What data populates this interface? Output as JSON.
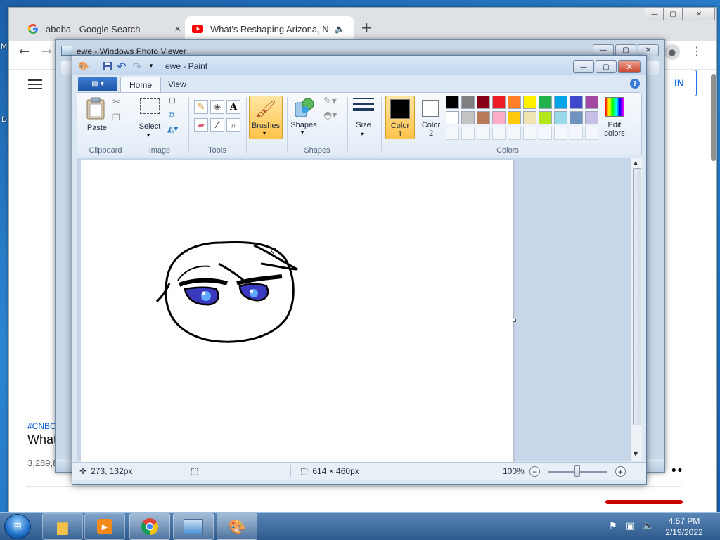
{
  "desktop": {
    "edge_left_top": "M",
    "edge_left_bottom": "D"
  },
  "browser": {
    "tabs": [
      {
        "label": "aboba - Google Search",
        "close": "×"
      },
      {
        "label": "What's Reshaping Arizona, N",
        "close": "×"
      }
    ],
    "new_tab": "+",
    "controls": {
      "minimize": "—",
      "maximize": "▢",
      "close": "✕"
    },
    "nav": {
      "back": "←",
      "forward": "→"
    },
    "page": {
      "sign_in": "IN",
      "hashtag": "#CNBC",
      "video_title": "What",
      "views": "3,289,8",
      "more": "••"
    }
  },
  "photo_viewer": {
    "title": "ewe - Windows Photo Viewer",
    "controls": {
      "minimize": "—",
      "maximize": "▢",
      "close": "✕"
    }
  },
  "paint": {
    "title": "ewe - Paint",
    "file_tab": "▤ ▾",
    "tabs": {
      "home": "Home",
      "view": "View"
    },
    "help": "?",
    "controls": {
      "minimize": "—",
      "maximize": "▢",
      "close": "✕"
    },
    "ribbon": {
      "clipboard": {
        "paste": "Paste",
        "group": "Clipboard"
      },
      "image": {
        "select": "Select",
        "group": "Image"
      },
      "tools": {
        "group": "Tools"
      },
      "brushes": {
        "label": "Brushes"
      },
      "shapes": {
        "label": "Shapes",
        "group": "Shapes"
      },
      "size": {
        "label": "Size"
      },
      "colors": {
        "color1": "Color\n1",
        "color1_line1": "Color",
        "color1_line2": "1",
        "color2_line1": "Color",
        "color2_line2": "2",
        "edit_line1": "Edit",
        "edit_line2": "colors",
        "group": "Colors",
        "color1_value": "#000000",
        "color2_value": "#ffffff",
        "palette_row1": [
          "#000000",
          "#7f7f7f",
          "#880015",
          "#ed1c24",
          "#ff7f27",
          "#fff200",
          "#22b14c",
          "#00a2e8",
          "#3f48cc",
          "#a349a4"
        ],
        "palette_row2": [
          "#ffffff",
          "#c3c3c3",
          "#b97a57",
          "#ffaec9",
          "#ffc90e",
          "#efe4b0",
          "#b5e61d",
          "#99d9ea",
          "#7092be",
          "#c8bfe7"
        ]
      }
    },
    "status": {
      "cursor_pos": "273, 132px",
      "image_size": "614 × 460px",
      "zoom": "100%",
      "zoom_level": 100
    }
  },
  "taskbar": {
    "time": "4:57 PM",
    "date": "2/19/2022"
  }
}
